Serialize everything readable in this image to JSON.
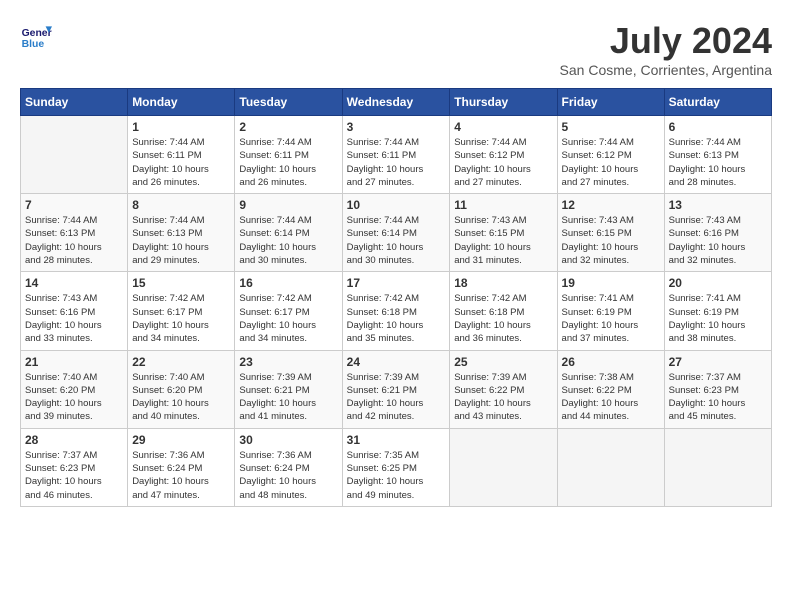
{
  "header": {
    "logo_line1": "General",
    "logo_line2": "Blue",
    "month_title": "July 2024",
    "location": "San Cosme, Corrientes, Argentina"
  },
  "days_of_week": [
    "Sunday",
    "Monday",
    "Tuesday",
    "Wednesday",
    "Thursday",
    "Friday",
    "Saturday"
  ],
  "weeks": [
    [
      {
        "day": "",
        "info": ""
      },
      {
        "day": "1",
        "info": "Sunrise: 7:44 AM\nSunset: 6:11 PM\nDaylight: 10 hours\nand 26 minutes."
      },
      {
        "day": "2",
        "info": "Sunrise: 7:44 AM\nSunset: 6:11 PM\nDaylight: 10 hours\nand 26 minutes."
      },
      {
        "day": "3",
        "info": "Sunrise: 7:44 AM\nSunset: 6:11 PM\nDaylight: 10 hours\nand 27 minutes."
      },
      {
        "day": "4",
        "info": "Sunrise: 7:44 AM\nSunset: 6:12 PM\nDaylight: 10 hours\nand 27 minutes."
      },
      {
        "day": "5",
        "info": "Sunrise: 7:44 AM\nSunset: 6:12 PM\nDaylight: 10 hours\nand 27 minutes."
      },
      {
        "day": "6",
        "info": "Sunrise: 7:44 AM\nSunset: 6:13 PM\nDaylight: 10 hours\nand 28 minutes."
      }
    ],
    [
      {
        "day": "7",
        "info": "Sunrise: 7:44 AM\nSunset: 6:13 PM\nDaylight: 10 hours\nand 28 minutes."
      },
      {
        "day": "8",
        "info": "Sunrise: 7:44 AM\nSunset: 6:13 PM\nDaylight: 10 hours\nand 29 minutes."
      },
      {
        "day": "9",
        "info": "Sunrise: 7:44 AM\nSunset: 6:14 PM\nDaylight: 10 hours\nand 30 minutes."
      },
      {
        "day": "10",
        "info": "Sunrise: 7:44 AM\nSunset: 6:14 PM\nDaylight: 10 hours\nand 30 minutes."
      },
      {
        "day": "11",
        "info": "Sunrise: 7:43 AM\nSunset: 6:15 PM\nDaylight: 10 hours\nand 31 minutes."
      },
      {
        "day": "12",
        "info": "Sunrise: 7:43 AM\nSunset: 6:15 PM\nDaylight: 10 hours\nand 32 minutes."
      },
      {
        "day": "13",
        "info": "Sunrise: 7:43 AM\nSunset: 6:16 PM\nDaylight: 10 hours\nand 32 minutes."
      }
    ],
    [
      {
        "day": "14",
        "info": "Sunrise: 7:43 AM\nSunset: 6:16 PM\nDaylight: 10 hours\nand 33 minutes."
      },
      {
        "day": "15",
        "info": "Sunrise: 7:42 AM\nSunset: 6:17 PM\nDaylight: 10 hours\nand 34 minutes."
      },
      {
        "day": "16",
        "info": "Sunrise: 7:42 AM\nSunset: 6:17 PM\nDaylight: 10 hours\nand 34 minutes."
      },
      {
        "day": "17",
        "info": "Sunrise: 7:42 AM\nSunset: 6:18 PM\nDaylight: 10 hours\nand 35 minutes."
      },
      {
        "day": "18",
        "info": "Sunrise: 7:42 AM\nSunset: 6:18 PM\nDaylight: 10 hours\nand 36 minutes."
      },
      {
        "day": "19",
        "info": "Sunrise: 7:41 AM\nSunset: 6:19 PM\nDaylight: 10 hours\nand 37 minutes."
      },
      {
        "day": "20",
        "info": "Sunrise: 7:41 AM\nSunset: 6:19 PM\nDaylight: 10 hours\nand 38 minutes."
      }
    ],
    [
      {
        "day": "21",
        "info": "Sunrise: 7:40 AM\nSunset: 6:20 PM\nDaylight: 10 hours\nand 39 minutes."
      },
      {
        "day": "22",
        "info": "Sunrise: 7:40 AM\nSunset: 6:20 PM\nDaylight: 10 hours\nand 40 minutes."
      },
      {
        "day": "23",
        "info": "Sunrise: 7:39 AM\nSunset: 6:21 PM\nDaylight: 10 hours\nand 41 minutes."
      },
      {
        "day": "24",
        "info": "Sunrise: 7:39 AM\nSunset: 6:21 PM\nDaylight: 10 hours\nand 42 minutes."
      },
      {
        "day": "25",
        "info": "Sunrise: 7:39 AM\nSunset: 6:22 PM\nDaylight: 10 hours\nand 43 minutes."
      },
      {
        "day": "26",
        "info": "Sunrise: 7:38 AM\nSunset: 6:22 PM\nDaylight: 10 hours\nand 44 minutes."
      },
      {
        "day": "27",
        "info": "Sunrise: 7:37 AM\nSunset: 6:23 PM\nDaylight: 10 hours\nand 45 minutes."
      }
    ],
    [
      {
        "day": "28",
        "info": "Sunrise: 7:37 AM\nSunset: 6:23 PM\nDaylight: 10 hours\nand 46 minutes."
      },
      {
        "day": "29",
        "info": "Sunrise: 7:36 AM\nSunset: 6:24 PM\nDaylight: 10 hours\nand 47 minutes."
      },
      {
        "day": "30",
        "info": "Sunrise: 7:36 AM\nSunset: 6:24 PM\nDaylight: 10 hours\nand 48 minutes."
      },
      {
        "day": "31",
        "info": "Sunrise: 7:35 AM\nSunset: 6:25 PM\nDaylight: 10 hours\nand 49 minutes."
      },
      {
        "day": "",
        "info": ""
      },
      {
        "day": "",
        "info": ""
      },
      {
        "day": "",
        "info": ""
      }
    ]
  ]
}
